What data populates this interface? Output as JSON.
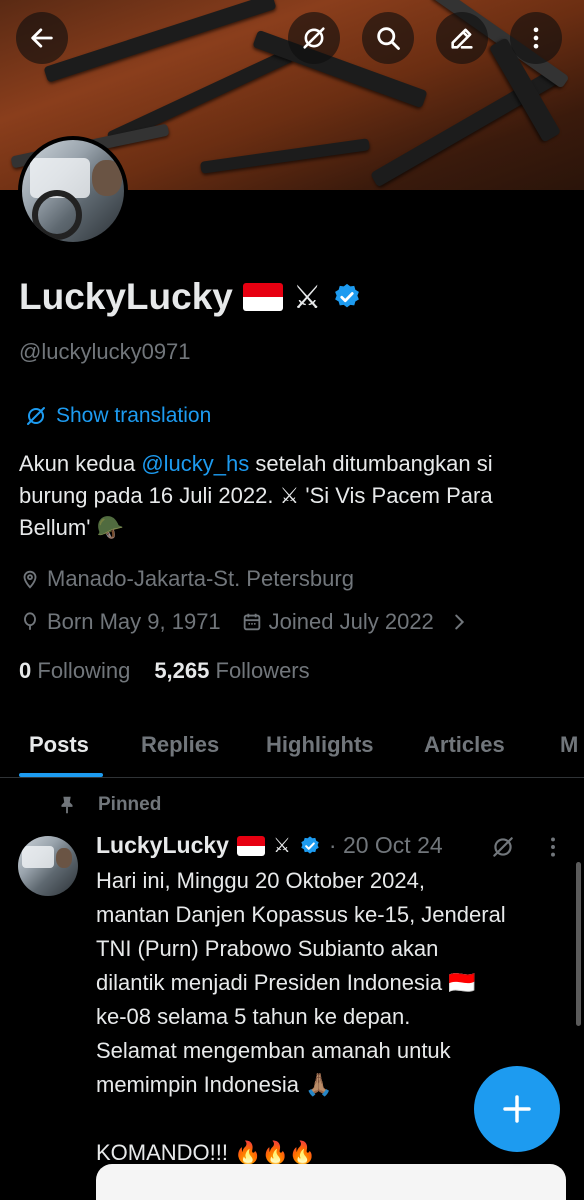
{
  "profile": {
    "name": "LuckyLucky",
    "swords": "⚔",
    "handle": "@luckylucky0971",
    "show_translation": "Show translation",
    "bio": {
      "line1_a": "Akun kedua ",
      "line1_mention": "@lucky_hs",
      "line1_b": " setelah ditumbangkan si",
      "line2": "burung pada 16 Juli 2022.  ⚔ 'Si Vis Pacem Para",
      "line3": "Bellum' 🪖"
    },
    "location": "Manado-Jakarta-St. Petersburg",
    "born": "Born May 9, 1971",
    "joined": "Joined July 2022",
    "following_count": "0",
    "following_label": "Following",
    "followers_count": "5,265",
    "followers_label": "Followers"
  },
  "tabs": [
    {
      "label": "Posts"
    },
    {
      "label": "Replies"
    },
    {
      "label": "Highlights"
    },
    {
      "label": "Articles"
    },
    {
      "label": "M"
    }
  ],
  "post": {
    "pinned_label": "Pinned",
    "author": "LuckyLucky",
    "date": "· 20 Oct 24",
    "lines": [
      "Hari ini, Minggu 20 Oktober 2024,",
      "mantan Danjen Kopassus ke-15, Jenderal",
      "TNI (Purn) Prabowo Subianto akan",
      "dilantik menjadi Presiden Indonesia 🇮🇩",
      "ke-08 selama 5 tahun ke depan.",
      "Selamat mengemban amanah untuk",
      "memimpin Indonesia 🙏🏽"
    ],
    "closing": "KOMANDO!!! 🔥🔥🔥"
  },
  "colors": {
    "accent": "#1d9bf0",
    "background": "#000000",
    "muted": "#71767b",
    "flag_red": "#e70011"
  },
  "icons": [
    "back-arrow-icon",
    "no-translate-icon",
    "search-icon",
    "edit-pencil-icon",
    "more-vertical-icon",
    "location-pin-icon",
    "balloon-icon",
    "calendar-icon",
    "chevron-right-icon",
    "pin-icon",
    "verified-badge-icon",
    "plus-icon"
  ]
}
